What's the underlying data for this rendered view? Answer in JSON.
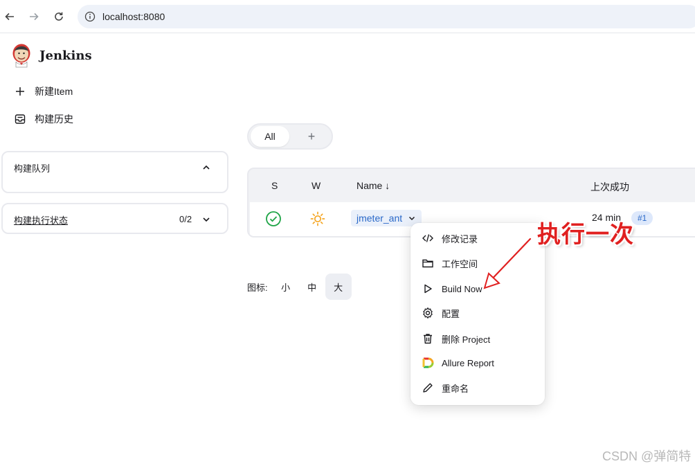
{
  "browser": {
    "url": "localhost:8080"
  },
  "header": {
    "brand": "Jenkins"
  },
  "sidebar": {
    "new_item": "新建Item",
    "build_history": "构建历史",
    "build_queue": {
      "title": "构建队列"
    },
    "executor_status": {
      "title": "构建执行状态",
      "count": "0/2"
    }
  },
  "tabs": {
    "all": "All",
    "add": "+"
  },
  "table": {
    "headers": {
      "s": "S",
      "w": "W",
      "name": "Name ↓",
      "last_success": "上次成功"
    },
    "rows": [
      {
        "name": "jmeter_ant",
        "last_success": "24 min",
        "build": "#1",
        "status": "success",
        "weather": "sunny"
      }
    ]
  },
  "icon_size": {
    "label": "图标:",
    "options": [
      "小",
      "中",
      "大"
    ],
    "selected": "大"
  },
  "menu": {
    "items": [
      {
        "label": "修改记录",
        "icon": "code-icon"
      },
      {
        "label": "工作空间",
        "icon": "folder-icon"
      },
      {
        "label": "Build Now",
        "icon": "play-icon"
      },
      {
        "label": "配置",
        "icon": "gear-icon"
      },
      {
        "label": "删除 Project",
        "icon": "trash-icon"
      },
      {
        "label": "Allure Report",
        "icon": "allure-icon"
      },
      {
        "label": "重命名",
        "icon": "pencil-icon"
      }
    ]
  },
  "annotation": {
    "text": "执行一次",
    "color": "#e02020"
  },
  "watermark": "CSDN @弹简特",
  "colors": {
    "link": "#2968c8",
    "success": "#1ea446",
    "sunny": "#f5a623"
  }
}
